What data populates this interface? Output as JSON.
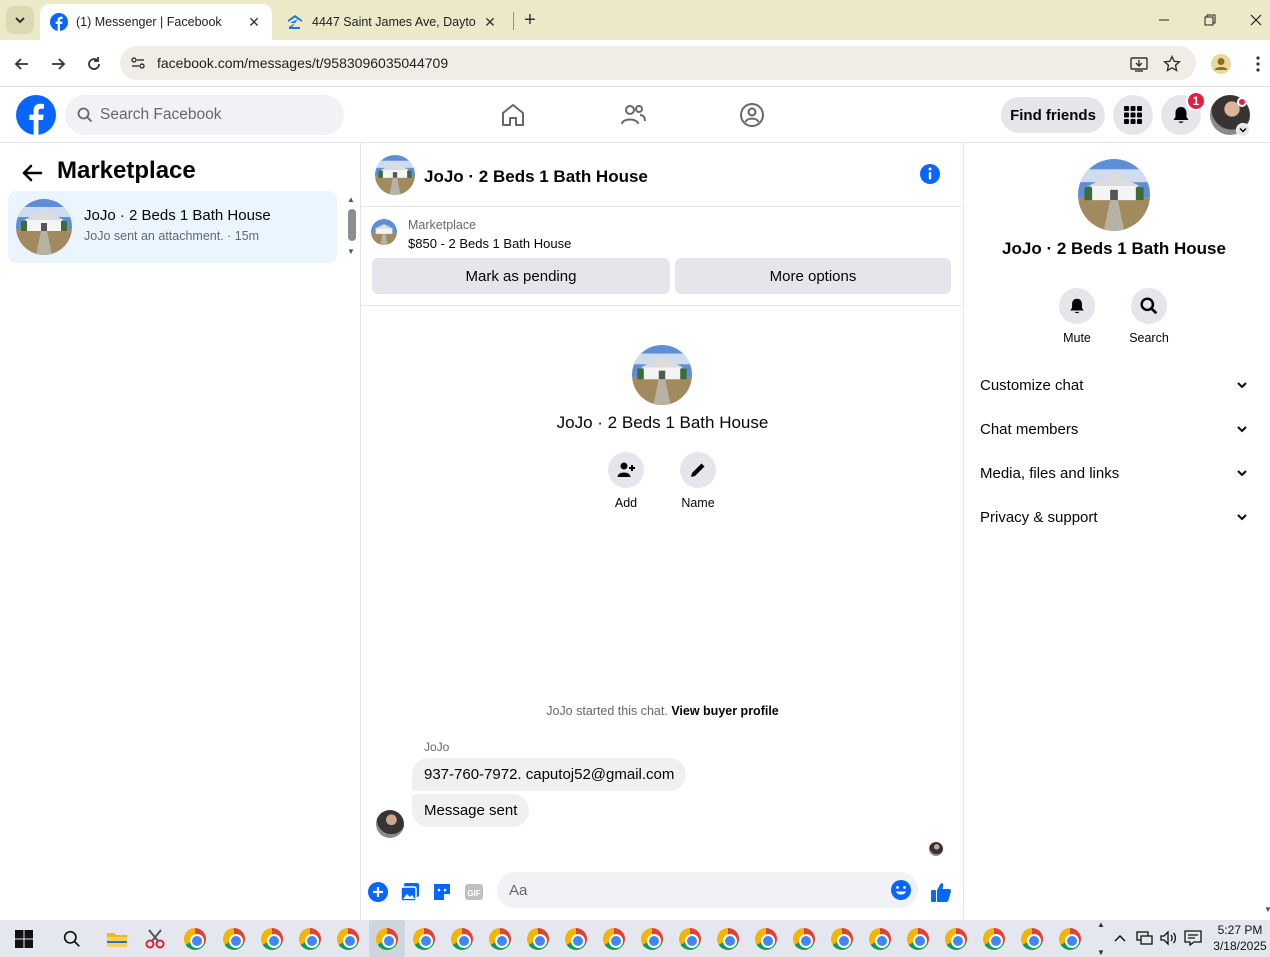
{
  "browser": {
    "tabs": [
      {
        "title": "(1) Messenger | Facebook",
        "active": true
      },
      {
        "title": "4447 Saint James Ave, Dayton, O",
        "active": false
      }
    ],
    "url": "facebook.com/messages/t/9583096035044709"
  },
  "fb_nav": {
    "search_placeholder": "Search Facebook",
    "find_friends": "Find friends",
    "notification_count": "1"
  },
  "left_panel": {
    "title": "Marketplace",
    "conversations": [
      {
        "name": "JoJo · 2 Beds 1 Bath House",
        "snippet": "JoJo sent an attachment. · 15m"
      }
    ]
  },
  "chat": {
    "header_name": "JoJo · 2 Beds 1 Bath House",
    "marketplace_label": "Marketplace",
    "listing": "$850 - 2 Beds 1 Bath House",
    "mark_pending": "Mark as pending",
    "more_options": "More options",
    "center_name": "JoJo · 2 Beds 1 Bath House",
    "actions": [
      {
        "label": "Add"
      },
      {
        "label": "Name"
      }
    ],
    "started_text": "JoJo started this chat.",
    "view_profile": "View buyer profile",
    "sender": "JoJo",
    "messages": [
      {
        "text": "937-760-7972. caputoj52@gmail.com"
      },
      {
        "text": "Message sent"
      }
    ],
    "composer_placeholder": "Aa"
  },
  "right_panel": {
    "name": "JoJo · 2 Beds 1 Bath House",
    "actions": [
      {
        "label": "Mute"
      },
      {
        "label": "Search"
      }
    ],
    "sections": [
      {
        "label": "Customize chat"
      },
      {
        "label": "Chat members"
      },
      {
        "label": "Media, files and links"
      },
      {
        "label": "Privacy & support"
      }
    ]
  },
  "taskbar": {
    "time": "5:27 PM",
    "date": "3/18/2025"
  },
  "colors": {
    "facebook_blue": "#0866ff",
    "selected_row": "#ebf5ff",
    "badge_red": "#e41e3f"
  }
}
